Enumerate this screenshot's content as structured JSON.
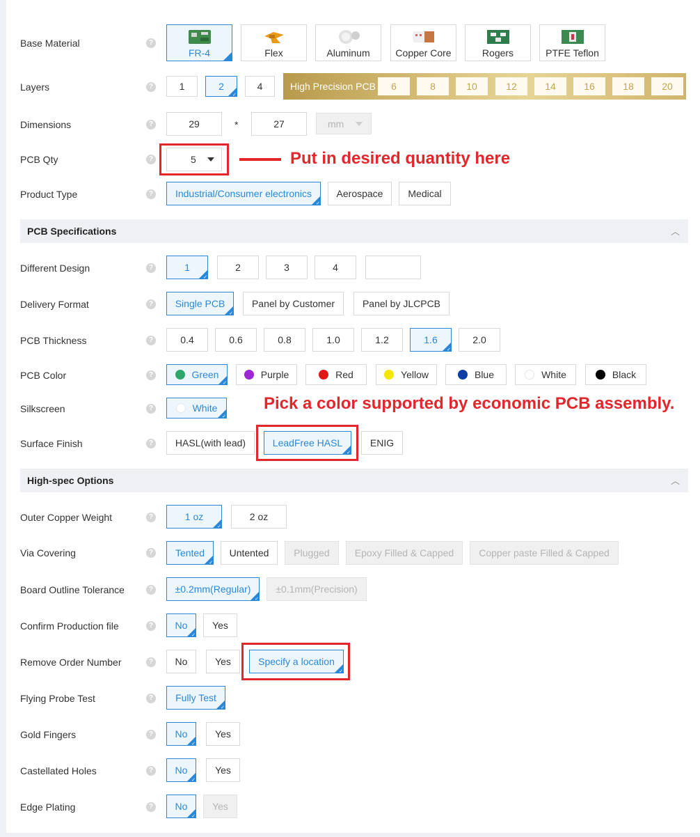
{
  "colors": {
    "accent": "#2b88d8",
    "annotation": "#e3262c",
    "gold": "#c9ac60"
  },
  "fields": {
    "base_material": "Base Material",
    "layers": "Layers",
    "dimensions": "Dimensions",
    "pcb_qty": "PCB Qty",
    "product_type": "Product Type",
    "different_design": "Different Design",
    "delivery_format": "Delivery Format",
    "pcb_thickness": "PCB Thickness",
    "pcb_color": "PCB Color",
    "silkscreen": "Silkscreen",
    "surface_finish": "Surface Finish",
    "outer_copper_weight": "Outer Copper Weight",
    "via_covering": "Via Covering",
    "board_outline_tolerance": "Board Outline Tolerance",
    "confirm_production_file": "Confirm Production file",
    "remove_order_number": "Remove Order Number",
    "flying_probe_test": "Flying Probe Test",
    "gold_fingers": "Gold Fingers",
    "castellated_holes": "Castellated Holes",
    "edge_plating": "Edge Plating"
  },
  "help_icon": "?",
  "base_material": {
    "options": [
      "FR-4",
      "Flex",
      "Aluminum",
      "Copper Core",
      "Rogers",
      "PTFE Teflon"
    ],
    "selected": "FR-4"
  },
  "layers": {
    "options": [
      "1",
      "2",
      "4"
    ],
    "selected": "2",
    "high_precision_label": "High Precision PCB",
    "high_precision_options": [
      "6",
      "8",
      "10",
      "12",
      "14",
      "16",
      "18",
      "20"
    ]
  },
  "dimensions": {
    "width": "29",
    "times": "*",
    "height": "27",
    "unit": "mm"
  },
  "pcb_qty": {
    "value": "5"
  },
  "product_type": {
    "options": [
      "Industrial/Consumer electronics",
      "Aerospace",
      "Medical"
    ],
    "selected": "Industrial/Consumer electronics"
  },
  "sections": {
    "pcb_specs": "PCB Specifications",
    "high_spec": "High-spec Options",
    "chevron": "︿"
  },
  "different_design": {
    "options": [
      "1",
      "2",
      "3",
      "4"
    ],
    "custom_value": "",
    "selected": "1"
  },
  "delivery_format": {
    "options": [
      "Single PCB",
      "Panel by Customer",
      "Panel by JLCPCB"
    ],
    "selected": "Single PCB"
  },
  "pcb_thickness": {
    "options": [
      "0.4",
      "0.6",
      "0.8",
      "1.0",
      "1.2",
      "1.6",
      "2.0"
    ],
    "selected": "1.6"
  },
  "pcb_color": {
    "options": [
      {
        "label": "Green",
        "color": "#2ea86a"
      },
      {
        "label": "Purple",
        "color": "#9b27d6"
      },
      {
        "label": "Red",
        "color": "#e01818"
      },
      {
        "label": "Yellow",
        "color": "#f3e600"
      },
      {
        "label": "Blue",
        "color": "#0d3fa6"
      },
      {
        "label": "White",
        "color": "#ffffff"
      },
      {
        "label": "Black",
        "color": "#000000"
      }
    ],
    "selected": "Green"
  },
  "silkscreen": {
    "value": "White"
  },
  "surface_finish": {
    "options": [
      "HASL(with lead)",
      "LeadFree HASL",
      "ENIG"
    ],
    "selected": "LeadFree HASL"
  },
  "outer_copper_weight": {
    "options": [
      "1 oz",
      "2 oz"
    ],
    "selected": "1 oz"
  },
  "via_covering": {
    "options": [
      "Tented",
      "Untented",
      "Plugged",
      "Epoxy Filled & Capped",
      "Copper paste Filled & Capped"
    ],
    "selected": "Tented"
  },
  "board_outline_tolerance": {
    "options": [
      "±0.2mm(Regular)",
      "±0.1mm(Precision)"
    ],
    "selected": "±0.2mm(Regular)"
  },
  "confirm_production_file": {
    "options": [
      "No",
      "Yes"
    ],
    "selected": "No"
  },
  "remove_order_number": {
    "options": [
      "No",
      "Yes",
      "Specify a location"
    ],
    "selected": "Specify a location"
  },
  "flying_probe_test": {
    "value": "Fully Test"
  },
  "gold_fingers": {
    "options": [
      "No",
      "Yes"
    ],
    "selected": "No"
  },
  "castellated_holes": {
    "options": [
      "No",
      "Yes"
    ],
    "selected": "No"
  },
  "edge_plating": {
    "options": [
      "No",
      "Yes"
    ],
    "selected": "No"
  },
  "annotations": {
    "qty": "Put in desired quantity here",
    "color": "Pick a color supported by economic PCB assembly."
  }
}
